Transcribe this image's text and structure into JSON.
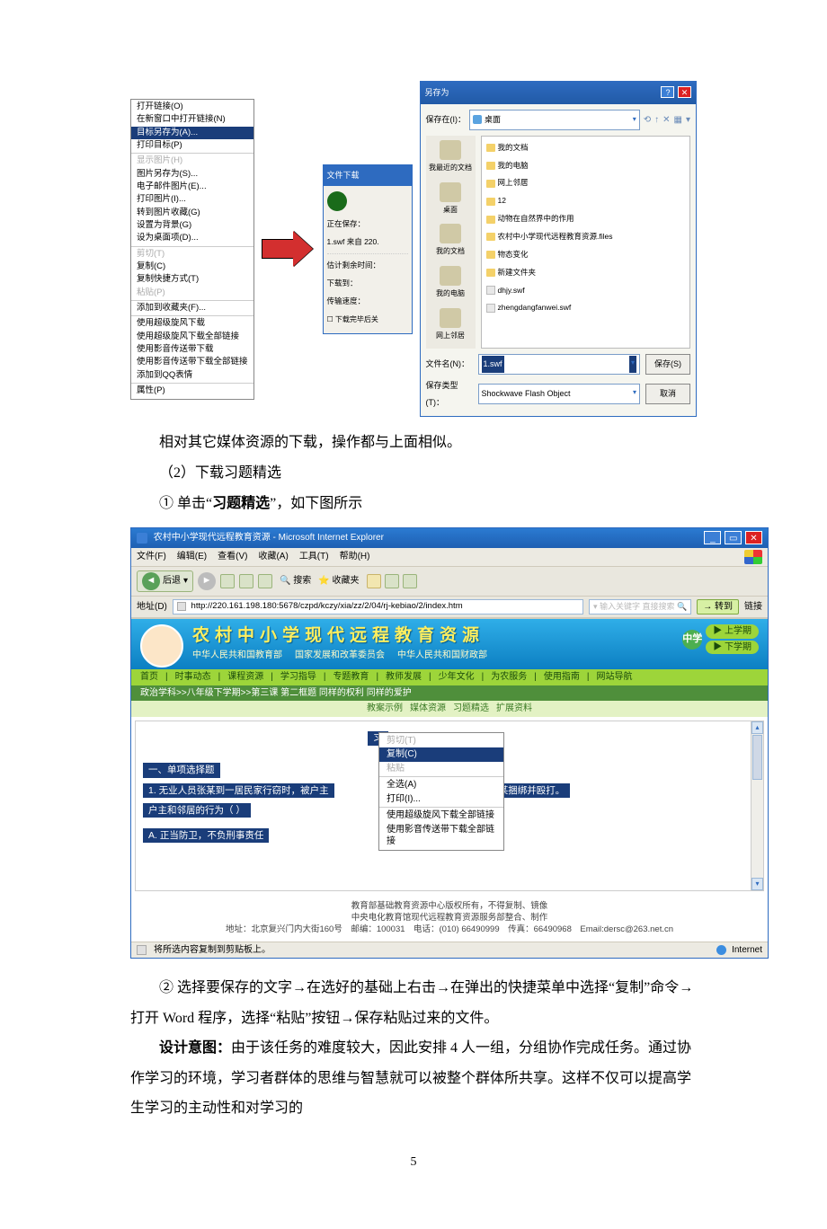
{
  "ctxMenu": {
    "sections": [
      {
        "items": [
          {
            "label": "打开链接(O)"
          },
          {
            "label": "在新窗口中打开链接(N)"
          },
          {
            "label": "目标另存为(A)...",
            "hl": true
          },
          {
            "label": "打印目标(P)"
          }
        ]
      },
      {
        "items": [
          {
            "label": "显示图片(H)",
            "disabled": true
          },
          {
            "label": "图片另存为(S)..."
          },
          {
            "label": "电子邮件图片(E)..."
          },
          {
            "label": "打印图片(I)..."
          },
          {
            "label": "转到图片收藏(G)"
          },
          {
            "label": "设置为背景(G)"
          },
          {
            "label": "设为桌面项(D)..."
          }
        ]
      },
      {
        "items": [
          {
            "label": "剪切(T)",
            "disabled": true
          },
          {
            "label": "复制(C)"
          },
          {
            "label": "复制快捷方式(T)"
          },
          {
            "label": "粘贴(P)",
            "disabled": true
          }
        ]
      },
      {
        "items": [
          {
            "label": "添加到收藏夹(F)..."
          }
        ]
      },
      {
        "items": [
          {
            "label": "使用超级旋风下载"
          },
          {
            "label": "使用超级旋风下载全部链接"
          },
          {
            "label": "使用影音传送带下载"
          },
          {
            "label": "使用影音传送带下载全部链接"
          },
          {
            "label": "添加到QQ表情"
          }
        ]
      },
      {
        "items": [
          {
            "label": "属性(P)"
          }
        ]
      }
    ]
  },
  "dl": {
    "title": "文件下载",
    "saving": "正在保存：",
    "file": "1.swf 来自 220.",
    "remainLbl": "估计剩余时间：",
    "toLbl": "下载到：",
    "speedLbl": "传输速度：",
    "closeAfter": "下载完毕后关"
  },
  "saveas": {
    "title": "另存为",
    "saveInLbl": "保存在(I)：",
    "saveIn": "桌面",
    "toolbarIcons": [
      "⟲",
      "↑",
      "✕",
      "▦",
      "▾"
    ],
    "places": [
      "我最近的文档",
      "桌面",
      "我的文档",
      "我的电脑",
      "网上邻居"
    ],
    "list": [
      {
        "type": "dir",
        "name": "我的文档"
      },
      {
        "type": "dir",
        "name": "我的电脑"
      },
      {
        "type": "dir",
        "name": "网上邻居"
      },
      {
        "type": "dir",
        "name": "12"
      },
      {
        "type": "dir",
        "name": "动物在自然界中的作用"
      },
      {
        "type": "dir",
        "name": "农村中小学现代远程教育资源.files"
      },
      {
        "type": "dir",
        "name": "物态变化"
      },
      {
        "type": "dir",
        "name": "新建文件夹"
      },
      {
        "type": "file",
        "name": "dhjy.swf"
      },
      {
        "type": "file",
        "name": "zhengdangfanwei.swf"
      }
    ],
    "fileLbl": "文件名(N)：",
    "fileName": "1.swf",
    "typeLbl": "保存类型(T)：",
    "typeName": "Shockwave Flash Object",
    "saveBtn": "保存(S)",
    "cancelBtn": "取消"
  },
  "text": {
    "line1": "相对其它媒体资源的下载，操作都与上面相似。",
    "line2": "（2）下载习题精选",
    "line3a": "①  单击“",
    "line3b": "习题精选",
    "line3c": "”，如下图所示",
    "line4": "② 选择要保存的文字→在选好的基础上右击→在弹出的快捷菜单中选择“复制”命令→打开 Word 程序，选择“粘贴”按钮→保存粘贴过来的文件。",
    "line5a": "设计意图：",
    "line5b": "由于该任务的难度较大，因此安排 4 人一组，分组协作完成任务。通过协作学习的环境，学习者群体的思维与智慧就可以被整个群体所共享。这样不仅可以提高学生学习的主动性和对学习的",
    "pageNum": "5"
  },
  "browser": {
    "title": "农村中小学现代远程教育资源 - Microsoft Internet Explorer",
    "menus": [
      "文件(F)",
      "编辑(E)",
      "查看(V)",
      "收藏(A)",
      "工具(T)",
      "帮助(H)"
    ],
    "back": "后退",
    "tools": [
      "🔍 搜索",
      "⭐ 收藏夹"
    ],
    "addrLbl": "地址(D)",
    "url": "http://220.161.198.180:5678/czpd/kczy/xia/zz/2/04/rj-kebiao/2/index.htm",
    "searchPh": "输入关键字 直接搜索",
    "go": "转到",
    "links": "链接",
    "banner": {
      "big": "农村中小学现代远程教育资源",
      "subs": [
        "中华人民共和国教育部",
        "国家发展和改革委员会",
        "中华人民共和国财政部"
      ],
      "zx": "中学",
      "sem1": "▶ 上学期",
      "sem2": "▶ 下学期"
    },
    "nav2": [
      "首页",
      "时事动态",
      "课程资源",
      "学习指导",
      "专题教育",
      "教师发展",
      "少年文化",
      "为农服务",
      "使用指南",
      "网站导航"
    ],
    "crumb": "政治学科>>八年级下学期>>第三课 第二框题 同样的权利 同样的爱护",
    "subnav": [
      "教案示例",
      "媒体资源",
      "习题精选",
      "扩展资料"
    ],
    "sel": {
      "l0": "习",
      "l1": "一、单项选择题",
      "l2a": "1. 无业人员张某到一居民家行窃时，被户主",
      "l2b": "居将张某捆绑并殴打。",
      "l3": "户主和邻居的行为（   ）",
      "l4": "A. 正当防卫，不负刑事责任"
    },
    "ctx2": {
      "sections": [
        {
          "items": [
            {
              "label": "剪切(T)",
              "dis": true
            },
            {
              "label": "复制(C)",
              "hl": true
            },
            {
              "label": "粘贴",
              "dis": true
            }
          ]
        },
        {
          "items": [
            {
              "label": "全选(A)"
            },
            {
              "label": "打印(I)..."
            }
          ]
        },
        {
          "items": [
            {
              "label": "使用超级旋风下载全部链接"
            },
            {
              "label": "使用影音传送带下载全部链接"
            }
          ]
        }
      ]
    },
    "footer": {
      "l1": "教育部基础教育资源中心版权所有，不得复制、镜像",
      "l2": "中央电化教育馆现代远程教育资源服务部整合、制作",
      "l3": "地址：北京复兴门内大街160号　邮编：100031　电话：(010) 66490999　传真：66490968　Email:dersc@263.net.cn"
    },
    "status": "将所选内容复制到剪贴板上。",
    "internet": "Internet"
  }
}
